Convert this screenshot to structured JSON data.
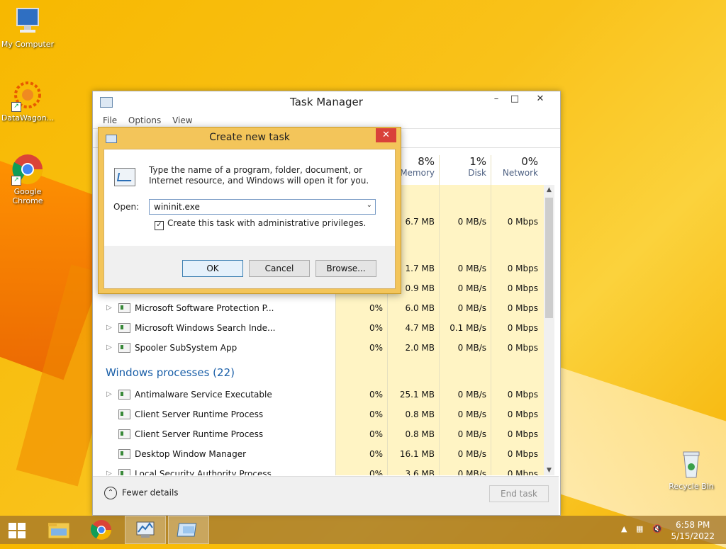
{
  "desktop": {
    "icons": [
      {
        "label": "My Computer"
      },
      {
        "label": "DataWagon..."
      },
      {
        "label": "Google Chrome"
      },
      {
        "label": "Recycle Bin"
      }
    ]
  },
  "task_manager": {
    "title": "Task Manager",
    "menu": [
      "File",
      "Options",
      "View"
    ],
    "columns": [
      {
        "pct": "8%",
        "label": "Memory"
      },
      {
        "pct": "1%",
        "label": "Disk"
      },
      {
        "pct": "0%",
        "label": "Network"
      }
    ],
    "rows_top": [
      {
        "memory": "6.7 MB",
        "disk": "0 MB/s",
        "network": "0 Mbps"
      },
      {
        "memory": "1.7 MB",
        "disk": "0 MB/s",
        "network": "0 Mbps"
      },
      {
        "memory": "0.9 MB",
        "disk": "0 MB/s",
        "network": "0 Mbps"
      }
    ],
    "rows_bg": [
      {
        "name": "Microsoft Software Protection P...",
        "cpu": "0%",
        "memory": "6.0 MB",
        "disk": "0 MB/s",
        "network": "0 Mbps"
      },
      {
        "name": "Microsoft Windows Search Inde...",
        "cpu": "0%",
        "memory": "4.7 MB",
        "disk": "0.1 MB/s",
        "network": "0 Mbps"
      },
      {
        "name": "Spooler SubSystem App",
        "cpu": "0%",
        "memory": "2.0 MB",
        "disk": "0 MB/s",
        "network": "0 Mbps"
      }
    ],
    "windows_section": "Windows processes (22)",
    "rows_win": [
      {
        "name": "Antimalware Service Executable",
        "cpu": "0%",
        "memory": "25.1 MB",
        "disk": "0 MB/s",
        "network": "0 Mbps"
      },
      {
        "name": "Client Server Runtime Process",
        "cpu": "0%",
        "memory": "0.8 MB",
        "disk": "0 MB/s",
        "network": "0 Mbps"
      },
      {
        "name": "Client Server Runtime Process",
        "cpu": "0%",
        "memory": "0.8 MB",
        "disk": "0 MB/s",
        "network": "0 Mbps"
      },
      {
        "name": "Desktop Window Manager",
        "cpu": "0%",
        "memory": "16.1 MB",
        "disk": "0 MB/s",
        "network": "0 Mbps"
      },
      {
        "name": "Local Security Authority Process",
        "cpu": "0%",
        "memory": "3.6 MB",
        "disk": "0 MB/s",
        "network": "0 Mbps"
      }
    ],
    "fewer_details": "Fewer details",
    "end_task": "End task"
  },
  "dialog": {
    "title": "Create new task",
    "description": "Type the name of a program, folder, document, or Internet resource, and Windows will open it for you.",
    "open_label": "Open:",
    "open_value": "wininit.exe",
    "admin_checkbox": "Create this task with administrative privileges.",
    "admin_checked": true,
    "ok": "OK",
    "cancel": "Cancel",
    "browse": "Browse..."
  },
  "taskbar": {
    "time": "6:58 PM",
    "date": "5/15/2022"
  }
}
